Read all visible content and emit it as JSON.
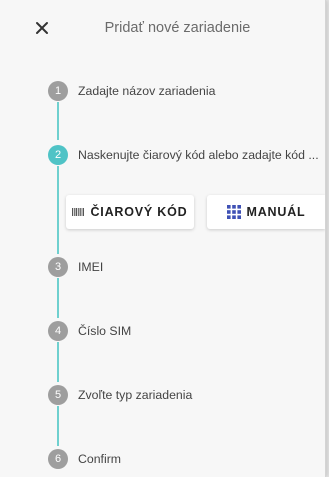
{
  "header": {
    "title": "Pridať nové zariadenie"
  },
  "steps": [
    {
      "number": "1",
      "label": "Zadajte názov zariadenia"
    },
    {
      "number": "2",
      "label": "Naskenujte čiarový kód alebo zadajte kód ..."
    },
    {
      "number": "3",
      "label": "IMEI"
    },
    {
      "number": "4",
      "label": "Číslo SIM"
    },
    {
      "number": "5",
      "label": "Zvoľte typ zariadenia"
    },
    {
      "number": "6",
      "label": "Confirm"
    }
  ],
  "methods": {
    "barcode_label": "ČIAROVÝ KÓD",
    "manual_label": "MANUÁL"
  },
  "colors": {
    "active": "#4fc3c6",
    "inactive": "#9e9e9e",
    "manual_icon": "#3f51b5"
  }
}
